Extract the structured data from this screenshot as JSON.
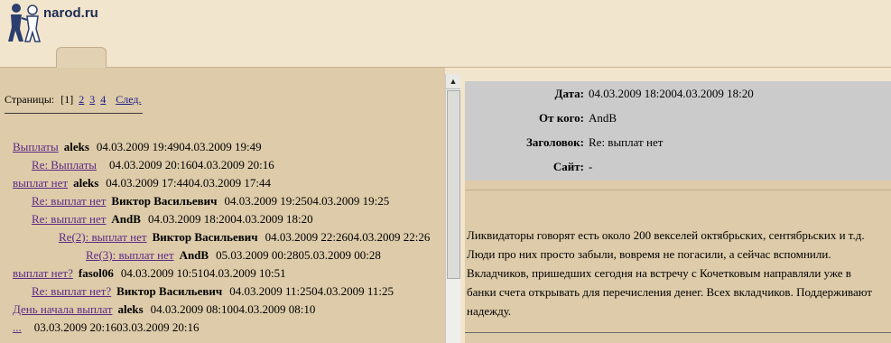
{
  "site": {
    "logo_text": "narod.ru"
  },
  "pager": {
    "label": "Страницы:",
    "current": "[1]",
    "pages": [
      "2",
      "3",
      "4"
    ],
    "next": "След."
  },
  "tree": [
    {
      "indent": 14,
      "title": "Выплаты",
      "author": "aleks",
      "date": "04.03.2009 19:4904.03.2009 19:49"
    },
    {
      "indent": 35,
      "title": "Re: Выплаты",
      "author": "",
      "date": "04.03.2009 20:1604.03.2009 20:16"
    },
    {
      "indent": 14,
      "title": "выплат нет",
      "author": "aleks",
      "date": "04.03.2009 17:4404.03.2009 17:44"
    },
    {
      "indent": 35,
      "title": "Re: выплат нет",
      "author": "Виктор Васильевич",
      "date": "04.03.2009 19:2504.03.2009 19:25"
    },
    {
      "indent": 35,
      "title": "Re: выплат нет",
      "author": "AndB",
      "date": "04.03.2009 18:2004.03.2009 18:20"
    },
    {
      "indent": 65,
      "title": "Re(2): выплат нет",
      "author": "Виктор Васильевич",
      "date": "04.03.2009 22:2604.03.2009 22:26"
    },
    {
      "indent": 95,
      "title": "Re(3): выплат нет",
      "author": "AndB",
      "date": "05.03.2009 00:2805.03.2009 00:28"
    },
    {
      "indent": 14,
      "title": "выплат нет?",
      "author": "fasol06",
      "date": "04.03.2009 10:5104.03.2009 10:51"
    },
    {
      "indent": 35,
      "title": "Re: выплат нет?",
      "author": "Виктор Васильевич",
      "date": "04.03.2009 11:2504.03.2009 11:25"
    },
    {
      "indent": 14,
      "title": "День начала выплат",
      "author": "aleks",
      "date": "04.03.2009 08:1004.03.2009 08:10"
    },
    {
      "indent": 14,
      "title": "...",
      "author": "",
      "date": "03.03.2009 20:1603.03.2009 20:16"
    }
  ],
  "message": {
    "labels": {
      "date": "Дата:",
      "from": "От кого:",
      "subject": "Заголовок:",
      "site": "Сайт:"
    },
    "date": "04.03.2009 18:2004.03.2009 18:20",
    "from": "AndB",
    "subject": "Re: выплат нет",
    "site": "-",
    "body": "Ликвидаторы говорят есть около 200 векселей октябрьских, сентябрьских и т.д. Люди про них просто забыли, вовремя не погасили, а сейчас вспомнили. Вкладчиков, пришедших сегодня на встречу с Кочетковым направляли уже в банки счета открывать для перечисления денег. Всех вкладчиков. Поддерживают надежду."
  }
}
